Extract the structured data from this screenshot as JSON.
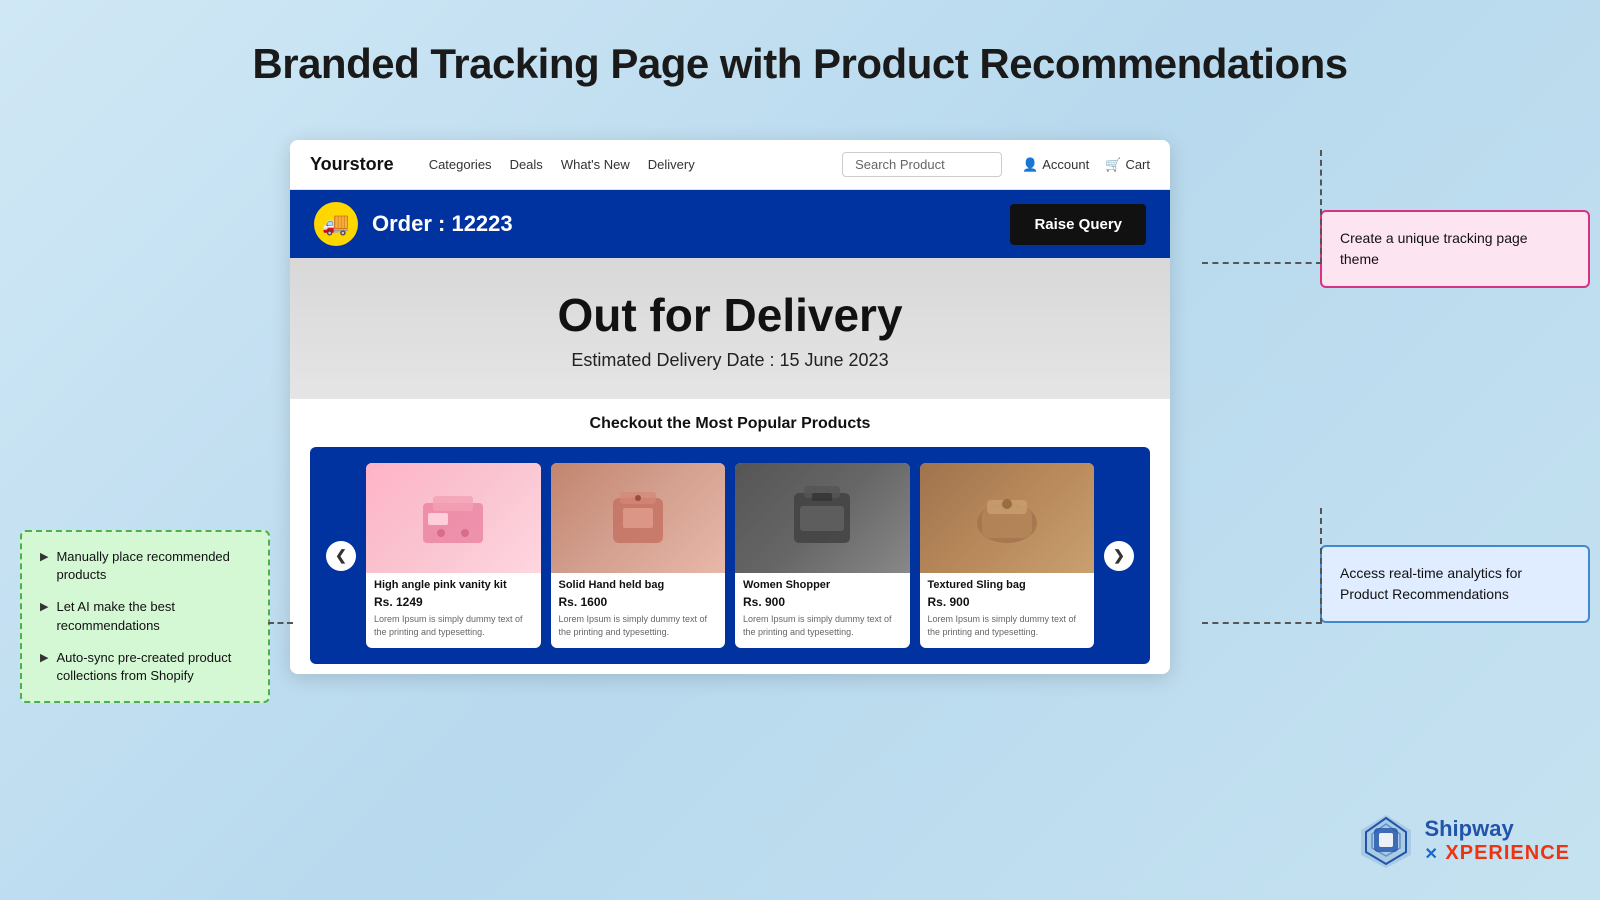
{
  "page": {
    "title": "Branded Tracking Page with Product Recommendations",
    "background_color": "#cce4f2"
  },
  "store_nav": {
    "logo": "Yourstore",
    "links": [
      "Categories",
      "Deals",
      "What's New",
      "Delivery"
    ],
    "search_placeholder": "Search Product",
    "actions": [
      "Account",
      "Cart"
    ]
  },
  "order_banner": {
    "order_label": "Order : 12223",
    "raise_query_btn": "Raise Query",
    "icon": "🚚"
  },
  "delivery_status": {
    "heading": "Out for Delivery",
    "date_label": "Estimated Delivery Date : 15 June 2023"
  },
  "products_section": {
    "title": "Checkout the Most Popular Products",
    "prev_btn": "❮",
    "next_btn": "❯",
    "products": [
      {
        "name": "High angle pink vanity kit",
        "price": "Rs. 1249",
        "description": "Lorem Ipsum is simply dummy text of the printing and typesetting.",
        "color_class": "prod-pink",
        "emoji": "👜"
      },
      {
        "name": "Solid Hand held bag",
        "price": "Rs. 1600",
        "description": "Lorem Ipsum is simply dummy text of the printing and typesetting.",
        "color_class": "prod-salmon",
        "emoji": "👝"
      },
      {
        "name": "Women Shopper",
        "price": "Rs. 900",
        "description": "Lorem Ipsum is simply dummy text of the printing and typesetting.",
        "color_class": "prod-dark",
        "emoji": "🎒"
      },
      {
        "name": "Textured Sling bag",
        "price": "Rs. 900",
        "description": "Lorem Ipsum is simply dummy text of the printing and typesetting.",
        "color_class": "prod-brown",
        "emoji": "💼"
      }
    ]
  },
  "left_callout": {
    "items": [
      "Manually place recommended products",
      "Let AI make the best recommendations",
      "Auto-sync pre-created product collections from Shopify"
    ]
  },
  "right_top_callout": {
    "text": "Create a unique tracking page theme"
  },
  "right_bottom_callout": {
    "text": "Access real-time analytics for Product Recommendations"
  },
  "shipway": {
    "name": "Shipway",
    "xperience": "XPERIENCE"
  }
}
